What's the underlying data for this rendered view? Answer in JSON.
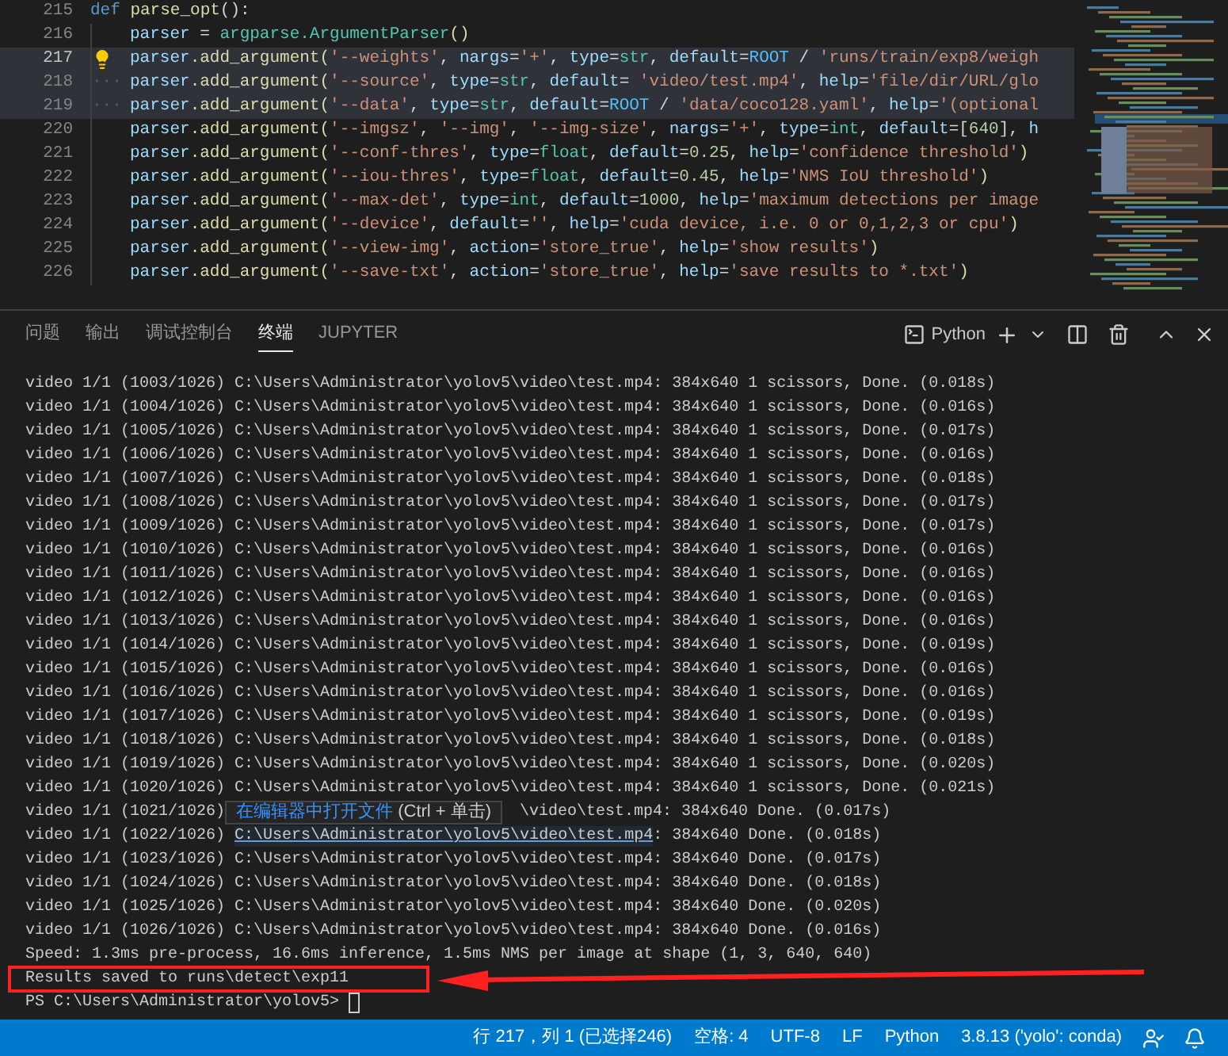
{
  "editor": {
    "lines": [
      {
        "number": "215",
        "current": false,
        "selected": false,
        "indented": false,
        "tokens": [
          {
            "text": "def",
            "kind": "kw"
          },
          {
            "text": " parse_opt",
            "kind": "func"
          },
          {
            "text": "():",
            "kind": "plain"
          }
        ]
      },
      {
        "number": "216",
        "current": false,
        "selected": false,
        "indented": true,
        "tokens": [
          {
            "text": "parser",
            "kind": "var"
          },
          {
            "text": " = ",
            "kind": "plain"
          },
          {
            "text": "argparse.ArgumentParser",
            "kind": "type"
          },
          {
            "text": "()",
            "kind": "func"
          }
        ]
      },
      {
        "number": "217",
        "current": true,
        "selected": true,
        "indented": true,
        "lightbulb": true,
        "tokens": [
          {
            "text": "parser",
            "kind": "var"
          },
          {
            "text": ".add_argument(",
            "kind": "func"
          },
          {
            "text": "'--weights'",
            "kind": "str"
          },
          {
            "text": ", ",
            "kind": "plain"
          },
          {
            "text": "nargs",
            "kind": "var"
          },
          {
            "text": "=",
            "kind": "plain"
          },
          {
            "text": "'+'",
            "kind": "str"
          },
          {
            "text": ", ",
            "kind": "plain"
          },
          {
            "text": "type",
            "kind": "var"
          },
          {
            "text": "=",
            "kind": "plain"
          },
          {
            "text": "str",
            "kind": "type"
          },
          {
            "text": ", ",
            "kind": "plain"
          },
          {
            "text": "default",
            "kind": "var"
          },
          {
            "text": "=",
            "kind": "plain"
          },
          {
            "text": "ROOT",
            "kind": "const"
          },
          {
            "text": " / ",
            "kind": "plain"
          },
          {
            "text": "'runs/train/exp8/weigh",
            "kind": "str"
          }
        ]
      },
      {
        "number": "218",
        "current": false,
        "selected": true,
        "indented": true,
        "marker": "···",
        "tokens": [
          {
            "text": "parser",
            "kind": "var"
          },
          {
            "text": ".add_argument(",
            "kind": "func"
          },
          {
            "text": "'--source'",
            "kind": "str"
          },
          {
            "text": ", ",
            "kind": "plain"
          },
          {
            "text": "type",
            "kind": "var"
          },
          {
            "text": "=",
            "kind": "plain"
          },
          {
            "text": "str",
            "kind": "type"
          },
          {
            "text": ", ",
            "kind": "plain"
          },
          {
            "text": "default",
            "kind": "var"
          },
          {
            "text": "= ",
            "kind": "plain"
          },
          {
            "text": "'video/test.mp4'",
            "kind": "str"
          },
          {
            "text": ", ",
            "kind": "plain"
          },
          {
            "text": "help",
            "kind": "var"
          },
          {
            "text": "=",
            "kind": "plain"
          },
          {
            "text": "'file/dir/URL/glo",
            "kind": "str"
          }
        ]
      },
      {
        "number": "219",
        "current": false,
        "selected": true,
        "indented": true,
        "marker": "···",
        "tokens": [
          {
            "text": "parser",
            "kind": "var"
          },
          {
            "text": ".add_argument(",
            "kind": "func"
          },
          {
            "text": "'--data'",
            "kind": "str"
          },
          {
            "text": ", ",
            "kind": "plain"
          },
          {
            "text": "type",
            "kind": "var"
          },
          {
            "text": "=",
            "kind": "plain"
          },
          {
            "text": "str",
            "kind": "type"
          },
          {
            "text": ", ",
            "kind": "plain"
          },
          {
            "text": "default",
            "kind": "var"
          },
          {
            "text": "=",
            "kind": "plain"
          },
          {
            "text": "ROOT",
            "kind": "const"
          },
          {
            "text": " / ",
            "kind": "plain"
          },
          {
            "text": "'data/coco128.yaml'",
            "kind": "str"
          },
          {
            "text": ", ",
            "kind": "plain"
          },
          {
            "text": "help",
            "kind": "var"
          },
          {
            "text": "=",
            "kind": "plain"
          },
          {
            "text": "'(optional",
            "kind": "str"
          }
        ]
      },
      {
        "number": "220",
        "current": false,
        "selected": false,
        "indented": true,
        "tokens": [
          {
            "text": "parser",
            "kind": "var"
          },
          {
            "text": ".add_argument(",
            "kind": "func"
          },
          {
            "text": "'--imgsz'",
            "kind": "str"
          },
          {
            "text": ", ",
            "kind": "plain"
          },
          {
            "text": "'--img'",
            "kind": "str"
          },
          {
            "text": ", ",
            "kind": "plain"
          },
          {
            "text": "'--img-size'",
            "kind": "str"
          },
          {
            "text": ", ",
            "kind": "plain"
          },
          {
            "text": "nargs",
            "kind": "var"
          },
          {
            "text": "=",
            "kind": "plain"
          },
          {
            "text": "'+'",
            "kind": "str"
          },
          {
            "text": ", ",
            "kind": "plain"
          },
          {
            "text": "type",
            "kind": "var"
          },
          {
            "text": "=",
            "kind": "plain"
          },
          {
            "text": "int",
            "kind": "type"
          },
          {
            "text": ", ",
            "kind": "plain"
          },
          {
            "text": "default",
            "kind": "var"
          },
          {
            "text": "=[",
            "kind": "plain"
          },
          {
            "text": "640",
            "kind": "num"
          },
          {
            "text": "], ",
            "kind": "plain"
          },
          {
            "text": "h",
            "kind": "var"
          }
        ]
      },
      {
        "number": "221",
        "current": false,
        "selected": false,
        "indented": true,
        "tokens": [
          {
            "text": "parser",
            "kind": "var"
          },
          {
            "text": ".add_argument(",
            "kind": "func"
          },
          {
            "text": "'--conf-thres'",
            "kind": "str"
          },
          {
            "text": ", ",
            "kind": "plain"
          },
          {
            "text": "type",
            "kind": "var"
          },
          {
            "text": "=",
            "kind": "plain"
          },
          {
            "text": "float",
            "kind": "type"
          },
          {
            "text": ", ",
            "kind": "plain"
          },
          {
            "text": "default",
            "kind": "var"
          },
          {
            "text": "=",
            "kind": "plain"
          },
          {
            "text": "0.25",
            "kind": "num"
          },
          {
            "text": ", ",
            "kind": "plain"
          },
          {
            "text": "help",
            "kind": "var"
          },
          {
            "text": "=",
            "kind": "plain"
          },
          {
            "text": "'confidence threshold'",
            "kind": "str"
          },
          {
            "text": ")",
            "kind": "func"
          }
        ]
      },
      {
        "number": "222",
        "current": false,
        "selected": false,
        "indented": true,
        "tokens": [
          {
            "text": "parser",
            "kind": "var"
          },
          {
            "text": ".add_argument(",
            "kind": "func"
          },
          {
            "text": "'--iou-thres'",
            "kind": "str"
          },
          {
            "text": ", ",
            "kind": "plain"
          },
          {
            "text": "type",
            "kind": "var"
          },
          {
            "text": "=",
            "kind": "plain"
          },
          {
            "text": "float",
            "kind": "type"
          },
          {
            "text": ", ",
            "kind": "plain"
          },
          {
            "text": "default",
            "kind": "var"
          },
          {
            "text": "=",
            "kind": "plain"
          },
          {
            "text": "0.45",
            "kind": "num"
          },
          {
            "text": ", ",
            "kind": "plain"
          },
          {
            "text": "help",
            "kind": "var"
          },
          {
            "text": "=",
            "kind": "plain"
          },
          {
            "text": "'NMS IoU threshold'",
            "kind": "str"
          },
          {
            "text": ")",
            "kind": "func"
          }
        ]
      },
      {
        "number": "223",
        "current": false,
        "selected": false,
        "indented": true,
        "tokens": [
          {
            "text": "parser",
            "kind": "var"
          },
          {
            "text": ".add_argument(",
            "kind": "func"
          },
          {
            "text": "'--max-det'",
            "kind": "str"
          },
          {
            "text": ", ",
            "kind": "plain"
          },
          {
            "text": "type",
            "kind": "var"
          },
          {
            "text": "=",
            "kind": "plain"
          },
          {
            "text": "int",
            "kind": "type"
          },
          {
            "text": ", ",
            "kind": "plain"
          },
          {
            "text": "default",
            "kind": "var"
          },
          {
            "text": "=",
            "kind": "plain"
          },
          {
            "text": "1000",
            "kind": "num"
          },
          {
            "text": ", ",
            "kind": "plain"
          },
          {
            "text": "help",
            "kind": "var"
          },
          {
            "text": "=",
            "kind": "plain"
          },
          {
            "text": "'maximum detections per image",
            "kind": "str"
          }
        ]
      },
      {
        "number": "224",
        "current": false,
        "selected": false,
        "indented": true,
        "tokens": [
          {
            "text": "parser",
            "kind": "var"
          },
          {
            "text": ".add_argument(",
            "kind": "func"
          },
          {
            "text": "'--device'",
            "kind": "str"
          },
          {
            "text": ", ",
            "kind": "plain"
          },
          {
            "text": "default",
            "kind": "var"
          },
          {
            "text": "=",
            "kind": "plain"
          },
          {
            "text": "''",
            "kind": "str"
          },
          {
            "text": ", ",
            "kind": "plain"
          },
          {
            "text": "help",
            "kind": "var"
          },
          {
            "text": "=",
            "kind": "plain"
          },
          {
            "text": "'cuda device, i.e. 0 or 0,1,2,3 or cpu'",
            "kind": "str"
          },
          {
            "text": ")",
            "kind": "func"
          }
        ]
      },
      {
        "number": "225",
        "current": false,
        "selected": false,
        "indented": true,
        "tokens": [
          {
            "text": "parser",
            "kind": "var"
          },
          {
            "text": ".add_argument(",
            "kind": "func"
          },
          {
            "text": "'--view-img'",
            "kind": "str"
          },
          {
            "text": ", ",
            "kind": "plain"
          },
          {
            "text": "action",
            "kind": "var"
          },
          {
            "text": "=",
            "kind": "plain"
          },
          {
            "text": "'store_true'",
            "kind": "str"
          },
          {
            "text": ", ",
            "kind": "plain"
          },
          {
            "text": "help",
            "kind": "var"
          },
          {
            "text": "=",
            "kind": "plain"
          },
          {
            "text": "'show results'",
            "kind": "str"
          },
          {
            "text": ")",
            "kind": "func"
          }
        ]
      },
      {
        "number": "226",
        "current": false,
        "selected": false,
        "indented": true,
        "tokens": [
          {
            "text": "parser",
            "kind": "var"
          },
          {
            "text": ".add_argument(",
            "kind": "func"
          },
          {
            "text": "'--save-txt'",
            "kind": "str"
          },
          {
            "text": ", ",
            "kind": "plain"
          },
          {
            "text": "action",
            "kind": "var"
          },
          {
            "text": "=",
            "kind": "plain"
          },
          {
            "text": "'store_true'",
            "kind": "str"
          },
          {
            "text": ", ",
            "kind": "plain"
          },
          {
            "text": "help",
            "kind": "var"
          },
          {
            "text": "=",
            "kind": "plain"
          },
          {
            "text": "'save results to *.txt'",
            "kind": "str"
          },
          {
            "text": ")",
            "kind": "func"
          }
        ]
      }
    ]
  },
  "panel": {
    "tabs": [
      {
        "label": "问题",
        "selected": false
      },
      {
        "label": "输出",
        "selected": false
      },
      {
        "label": "调试控制台",
        "selected": false
      },
      {
        "label": "终端",
        "selected": true
      },
      {
        "label": "JUPYTER",
        "selected": false
      }
    ],
    "terminal_name": "Python"
  },
  "terminal": {
    "tooltip": {
      "text": "在编辑器中打开文件",
      "shortcut": " (Ctrl + 单击)"
    },
    "lines": [
      {
        "segments": [
          {
            "kind": "plain",
            "text": "video 1/1 (1003/1026) C:\\Users\\Administrator\\yolov5\\video\\test.mp4: 384x640 1 scissors, Done. (0.018s)"
          }
        ]
      },
      {
        "segments": [
          {
            "kind": "plain",
            "text": "video 1/1 (1004/1026) C:\\Users\\Administrator\\yolov5\\video\\test.mp4: 384x640 1 scissors, Done. (0.016s)"
          }
        ]
      },
      {
        "segments": [
          {
            "kind": "plain",
            "text": "video 1/1 (1005/1026) C:\\Users\\Administrator\\yolov5\\video\\test.mp4: 384x640 1 scissors, Done. (0.017s)"
          }
        ]
      },
      {
        "segments": [
          {
            "kind": "plain",
            "text": "video 1/1 (1006/1026) C:\\Users\\Administrator\\yolov5\\video\\test.mp4: 384x640 1 scissors, Done. (0.016s)"
          }
        ]
      },
      {
        "segments": [
          {
            "kind": "plain",
            "text": "video 1/1 (1007/1026) C:\\Users\\Administrator\\yolov5\\video\\test.mp4: 384x640 1 scissors, Done. (0.018s)"
          }
        ]
      },
      {
        "segments": [
          {
            "kind": "plain",
            "text": "video 1/1 (1008/1026) C:\\Users\\Administrator\\yolov5\\video\\test.mp4: 384x640 1 scissors, Done. (0.017s)"
          }
        ]
      },
      {
        "segments": [
          {
            "kind": "plain",
            "text": "video 1/1 (1009/1026) C:\\Users\\Administrator\\yolov5\\video\\test.mp4: 384x640 1 scissors, Done. (0.017s)"
          }
        ]
      },
      {
        "segments": [
          {
            "kind": "plain",
            "text": "video 1/1 (1010/1026) C:\\Users\\Administrator\\yolov5\\video\\test.mp4: 384x640 1 scissors, Done. (0.016s)"
          }
        ]
      },
      {
        "segments": [
          {
            "kind": "plain",
            "text": "video 1/1 (1011/1026) C:\\Users\\Administrator\\yolov5\\video\\test.mp4: 384x640 1 scissors, Done. (0.016s)"
          }
        ]
      },
      {
        "segments": [
          {
            "kind": "plain",
            "text": "video 1/1 (1012/1026) C:\\Users\\Administrator\\yolov5\\video\\test.mp4: 384x640 1 scissors, Done. (0.016s)"
          }
        ]
      },
      {
        "segments": [
          {
            "kind": "plain",
            "text": "video 1/1 (1013/1026) C:\\Users\\Administrator\\yolov5\\video\\test.mp4: 384x640 1 scissors, Done. (0.016s)"
          }
        ]
      },
      {
        "segments": [
          {
            "kind": "plain",
            "text": "video 1/1 (1014/1026) C:\\Users\\Administrator\\yolov5\\video\\test.mp4: 384x640 1 scissors, Done. (0.019s)"
          }
        ]
      },
      {
        "segments": [
          {
            "kind": "plain",
            "text": "video 1/1 (1015/1026) C:\\Users\\Administrator\\yolov5\\video\\test.mp4: 384x640 1 scissors, Done. (0.016s)"
          }
        ]
      },
      {
        "segments": [
          {
            "kind": "plain",
            "text": "video 1/1 (1016/1026) C:\\Users\\Administrator\\yolov5\\video\\test.mp4: 384x640 1 scissors, Done. (0.016s)"
          }
        ]
      },
      {
        "segments": [
          {
            "kind": "plain",
            "text": "video 1/1 (1017/1026) C:\\Users\\Administrator\\yolov5\\video\\test.mp4: 384x640 1 scissors, Done. (0.019s)"
          }
        ]
      },
      {
        "segments": [
          {
            "kind": "plain",
            "text": "video 1/1 (1018/1026) C:\\Users\\Administrator\\yolov5\\video\\test.mp4: 384x640 1 scissors, Done. (0.018s)"
          }
        ]
      },
      {
        "segments": [
          {
            "kind": "plain",
            "text": "video 1/1 (1019/1026) C:\\Users\\Administrator\\yolov5\\video\\test.mp4: 384x640 1 scissors, Done. (0.020s)"
          }
        ]
      },
      {
        "segments": [
          {
            "kind": "plain",
            "text": "video 1/1 (1020/1026) C:\\Users\\Administrator\\yolov5\\video\\test.mp4: 384x640 1 scissors, Done. (0.021s)"
          }
        ]
      },
      {
        "segments": [
          {
            "kind": "plain",
            "text": "video 1/1 (1021/1026)"
          },
          {
            "kind": "covered"
          },
          {
            "kind": "plain",
            "text": "\\video\\test.mp4: 384x640 Done. (0.017s)"
          }
        ]
      },
      {
        "segments": [
          {
            "kind": "plain",
            "text": "video 1/1 (1022/1026)"
          },
          {
            "kind": "link",
            "text": "C:\\Users\\Administrator\\yolov5\\video\\test.mp4"
          },
          {
            "kind": "plain",
            "text": ": 384x640 Done. (0.018s)"
          }
        ]
      },
      {
        "segments": [
          {
            "kind": "plain",
            "text": "video 1/1 (1023/1026) C:\\Users\\Administrator\\yolov5\\video\\test.mp4: 384x640 Done. (0.017s)"
          }
        ]
      },
      {
        "segments": [
          {
            "kind": "plain",
            "text": "video 1/1 (1024/1026) C:\\Users\\Administrator\\yolov5\\video\\test.mp4: 384x640 Done. (0.018s)"
          }
        ]
      },
      {
        "segments": [
          {
            "kind": "plain",
            "text": "video 1/1 (1025/1026) C:\\Users\\Administrator\\yolov5\\video\\test.mp4: 384x640 Done. (0.020s)"
          }
        ]
      },
      {
        "segments": [
          {
            "kind": "plain",
            "text": "video 1/1 (1026/1026) C:\\Users\\Administrator\\yolov5\\video\\test.mp4: 384x640 Done. (0.016s)"
          }
        ]
      },
      {
        "segments": [
          {
            "kind": "plain",
            "text": "Speed: 1.3ms pre-process, 16.6ms inference, 1.5ms NMS per image at shape (1, 3, 640, 640)"
          }
        ]
      },
      {
        "highlighted": true,
        "segments": [
          {
            "kind": "plain",
            "text": "Results saved to runs\\detect\\exp11"
          }
        ]
      },
      {
        "segments": [
          {
            "kind": "plain",
            "text": "PS C:\\Users\\Administrator\\yolov5>"
          },
          {
            "kind": "cursor"
          }
        ]
      }
    ]
  },
  "status_bar": {
    "items": [
      "行 217，列 1 (已选择246)",
      "空格: 4",
      "UTF-8",
      "LF",
      "Python",
      "3.8.13 ('yolo': conda)"
    ]
  }
}
